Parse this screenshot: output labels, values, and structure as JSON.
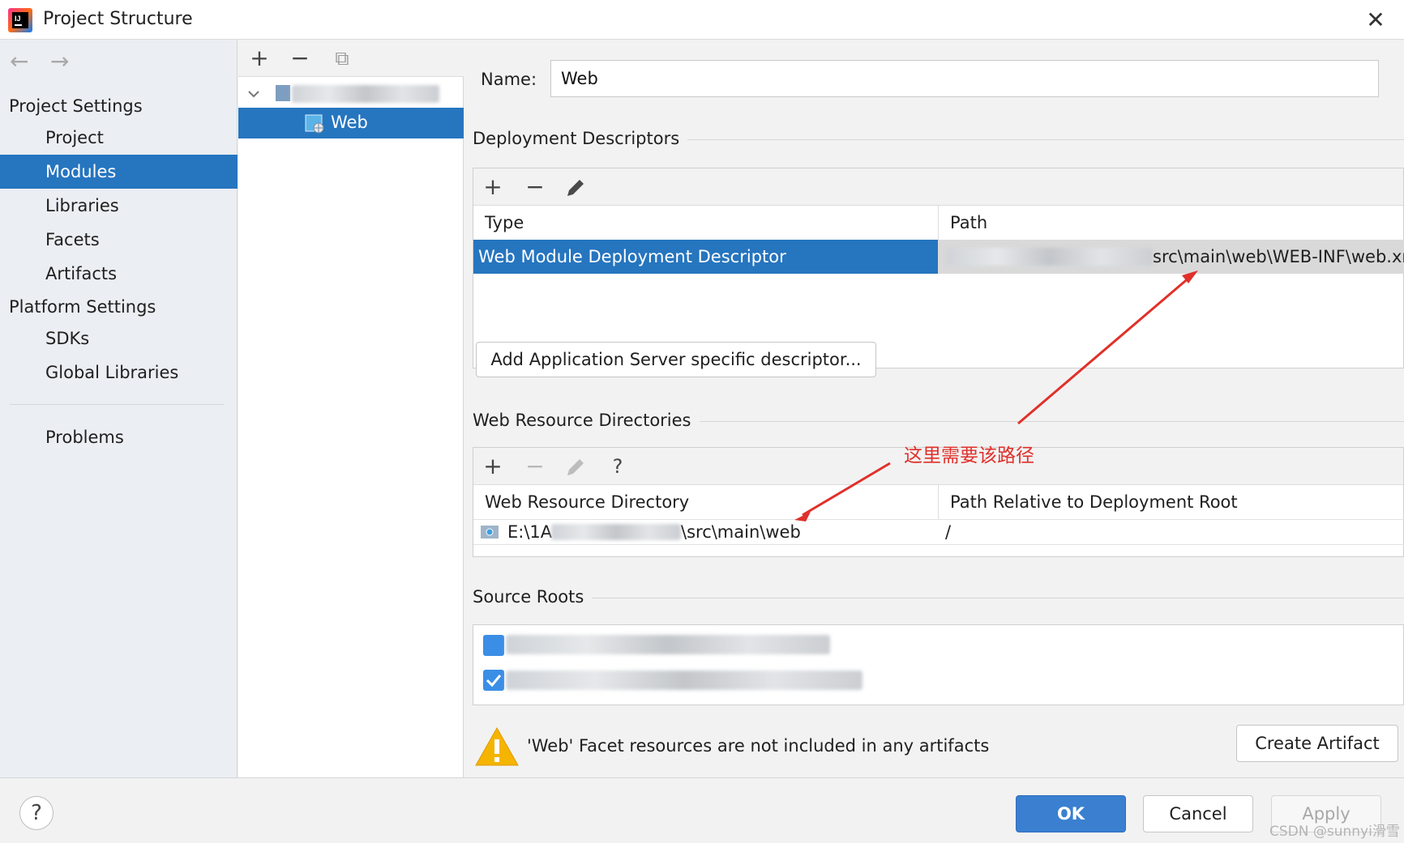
{
  "window": {
    "title": "Project Structure",
    "close_symbol": "✕"
  },
  "nav": {
    "back_symbol": "←",
    "forward_symbol": "→",
    "project_settings_header": "Project Settings",
    "project_settings_items": [
      "Project",
      "Modules",
      "Libraries",
      "Facets",
      "Artifacts"
    ],
    "platform_settings_header": "Platform Settings",
    "platform_settings_items": [
      "SDKs",
      "Global Libraries"
    ],
    "problems_label": "Problems",
    "selected_item": "Modules"
  },
  "tree": {
    "add_symbol": "+",
    "remove_symbol": "−",
    "copy_symbol": "⧉",
    "web_node_label": "Web"
  },
  "form": {
    "name_label": "Name:",
    "name_value": "Web"
  },
  "deployment": {
    "section_title": "Deployment Descriptors",
    "col_type": "Type",
    "col_path": "Path",
    "row_type": "Web Module Deployment Descriptor",
    "row_path_visible": "src\\main\\web\\WEB-INF\\web.xr",
    "add_server_descriptor_button": "Add Application Server specific descriptor..."
  },
  "web_resources": {
    "section_title": "Web Resource Directories",
    "col_directory": "Web Resource Directory",
    "col_relative": "Path Relative to Deployment Root",
    "row_dir_prefix": "E:\\1A",
    "row_dir_suffix": "\\src\\main\\web",
    "row_relative": "/",
    "help_symbol": "?"
  },
  "source_roots": {
    "section_title": "Source Roots"
  },
  "warning": {
    "text": "'Web' Facet resources are not included in any artifacts",
    "create_artifact_button": "Create Artifact"
  },
  "footer": {
    "help_symbol": "?",
    "ok_button": "OK",
    "cancel_button": "Cancel",
    "apply_button": "Apply"
  },
  "annotation": {
    "text": "这里需要该路径"
  },
  "watermark": "CSDN @sunnyi滑雪",
  "colors": {
    "selection_blue": "#2675bf",
    "primary_button": "#3a7fd0",
    "annotation_red": "#e0302a",
    "warning_yellow": "#f5b400"
  }
}
